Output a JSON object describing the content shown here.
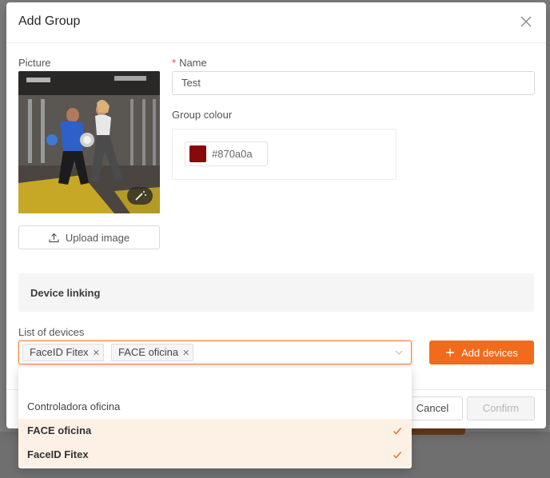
{
  "dialog": {
    "title": "Add Group",
    "picture_label": "Picture",
    "upload_label": "Upload image",
    "name_label": "Name",
    "name_value": "Test",
    "colour_label": "Group colour",
    "colour_hex": "#870a0a",
    "section_title": "Device linking",
    "devices_label": "List of devices",
    "selected_tags": [
      "FaceID Fitex",
      "FACE oficina"
    ],
    "add_devices_label": "Add devices",
    "cancel_label": "Cancel",
    "confirm_label": "Confirm"
  },
  "dropdown": {
    "options": [
      {
        "label": "Controladora oficina",
        "selected": false
      },
      {
        "label": "FACE oficina",
        "selected": true
      },
      {
        "label": "FaceID Fitex",
        "selected": true
      }
    ]
  },
  "colors": {
    "accent": "#f26a1b",
    "swatch": "#870a0a"
  }
}
